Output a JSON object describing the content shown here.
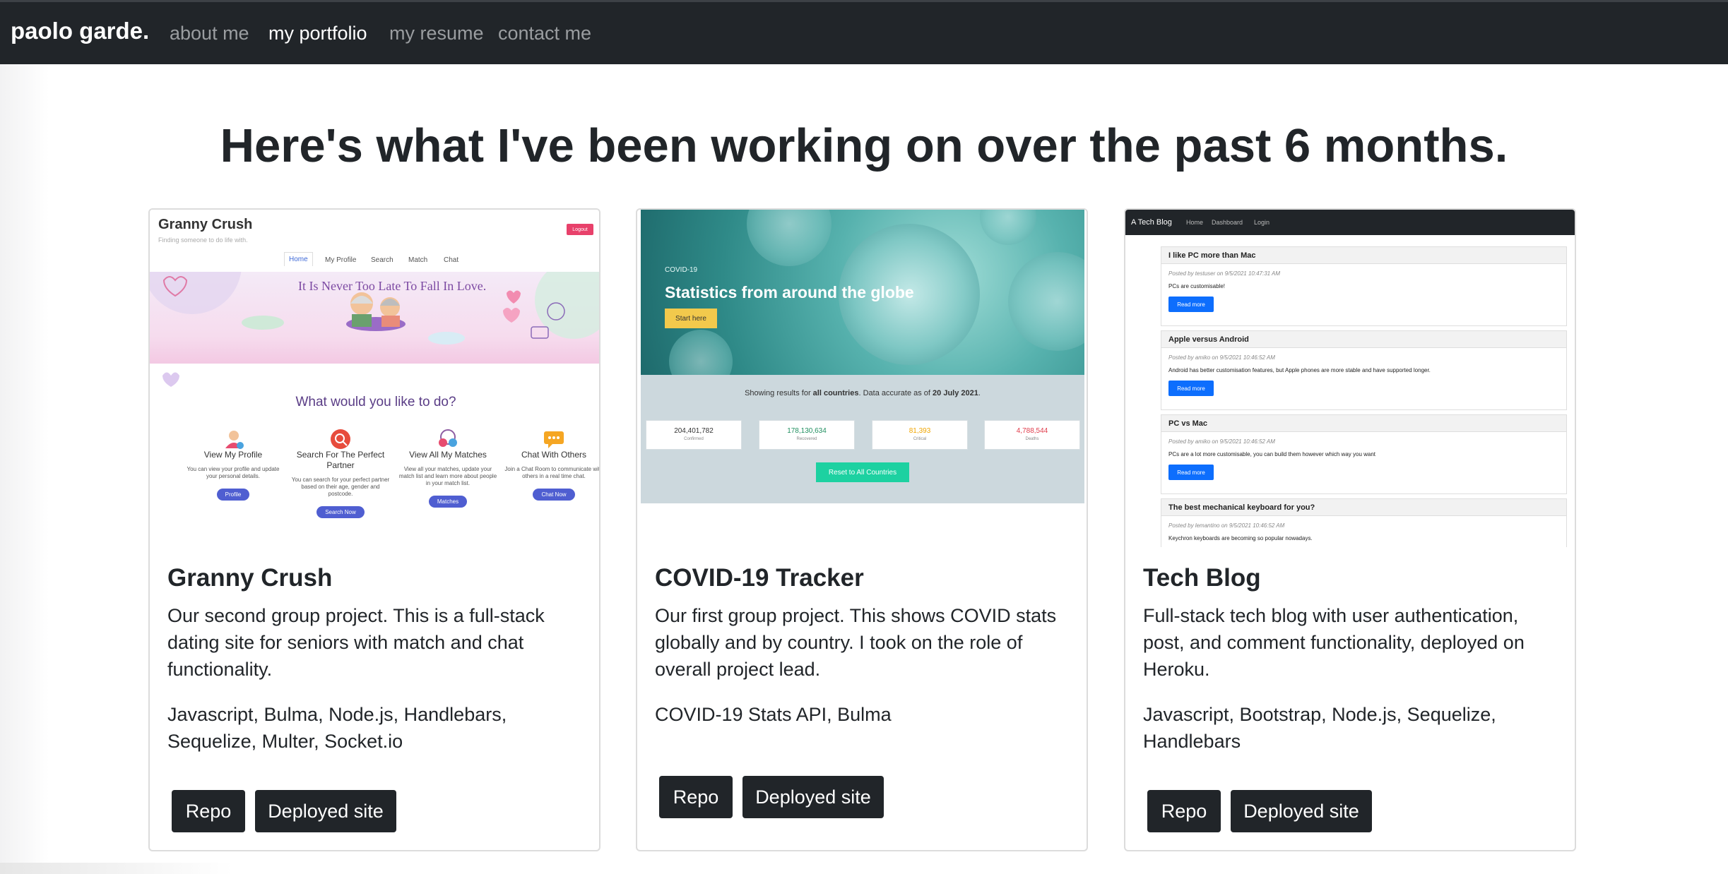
{
  "nav": {
    "brand": "paolo garde.",
    "links": [
      "about me",
      "my portfolio",
      "my resume",
      "contact me"
    ],
    "active": "my portfolio"
  },
  "headline": "Here's what I've been working on over the past 6 months.",
  "projects": [
    {
      "title": "Granny Crush",
      "description": "Our second group project. This is a full-stack dating site for seniors with match and chat functionality.",
      "tech": "Javascript, Bulma, Node.js, Handlebars, Sequelize, Multer, Socket.io",
      "repo_label": "Repo",
      "site_label": "Deployed site",
      "screenshot": {
        "site_title": "Granny Crush",
        "tagline": "Finding someone to do life with.",
        "logout": "Logout",
        "tabs": [
          "Home",
          "My Profile",
          "Search",
          "Match",
          "Chat"
        ],
        "banner": "It Is Never Too Late To Fall In Love.",
        "question": "What would you like to do?",
        "features": [
          {
            "title": "View My Profile",
            "desc": "You can view your profile and update your personal details.",
            "button": "Profile"
          },
          {
            "title": "Search For The Perfect Partner",
            "desc": "You can search for your perfect partner based on their age, gender and postcode.",
            "button": "Search Now"
          },
          {
            "title": "View All My Matches",
            "desc": "View all your matches, update your match list and learn more about people in your match list.",
            "button": "Matches"
          },
          {
            "title": "Chat With Others",
            "desc": "Join a Chat Room to communicate with others in a real time chat.",
            "button": "Chat Now"
          }
        ],
        "colors": {
          "accent": "#4f5ed1",
          "logout": "#e8416b",
          "question": "#5a3d86"
        }
      }
    },
    {
      "title": "COVID-19 Tracker",
      "description": "Our first group project. This shows COVID stats globally and by country. I took on the role of overall project lead.",
      "tech": "COVID-19 Stats API, Bulma",
      "repo_label": "Repo",
      "site_label": "Deployed site",
      "screenshot": {
        "small": "COVID-19",
        "heading": "Statistics from around the globe",
        "start": "Start here",
        "showing_prefix": "Showing results for ",
        "showing_bold": "all countries",
        "showing_mid": ". Data accurate as of ",
        "showing_date": "20 July 2021",
        "showing_end": ".",
        "stats": [
          {
            "value": "204,401,782",
            "label": "Confirmed",
            "color": "#333333"
          },
          {
            "value": "178,130,634",
            "label": "Recovered",
            "color": "#1f8f5f"
          },
          {
            "value": "81,393",
            "label": "Critical",
            "color": "#f0a500"
          },
          {
            "value": "4,788,544",
            "label": "Deaths",
            "color": "#e03c4b"
          }
        ],
        "reset": "Reset to All Countries"
      }
    },
    {
      "title": "Tech Blog",
      "description": "Full-stack tech blog with user authentication, post, and comment functionality, deployed on Heroku.",
      "tech": "Javascript, Bootstrap, Node.js, Sequelize, Handlebars",
      "repo_label": "Repo",
      "site_label": "Deployed site",
      "screenshot": {
        "brand": "A Tech Blog",
        "links": [
          "Home",
          "Dashboard",
          "Login"
        ],
        "read_more": "Read more",
        "posts": [
          {
            "title": "I like PC more than Mac",
            "meta": "Posted by testuser on 9/5/2021 10:47:31 AM",
            "body": "PCs are customisable!"
          },
          {
            "title": "Apple versus Android",
            "meta": "Posted by amiko on 9/5/2021 10:46:52 AM",
            "body": "Android has better customisation features, but Apple phones are more stable and have supported longer."
          },
          {
            "title": "PC vs Mac",
            "meta": "Posted by amiko on 9/5/2021 10:46:52 AM",
            "body": "PCs are a lot more customisable, you can build them however which way you want"
          },
          {
            "title": "The best mechanical keyboard for you?",
            "meta": "Posted by lemantino on 9/5/2021 10:46:52 AM",
            "body": "Keychron keyboards are becoming so popular nowadays."
          }
        ]
      }
    }
  ]
}
